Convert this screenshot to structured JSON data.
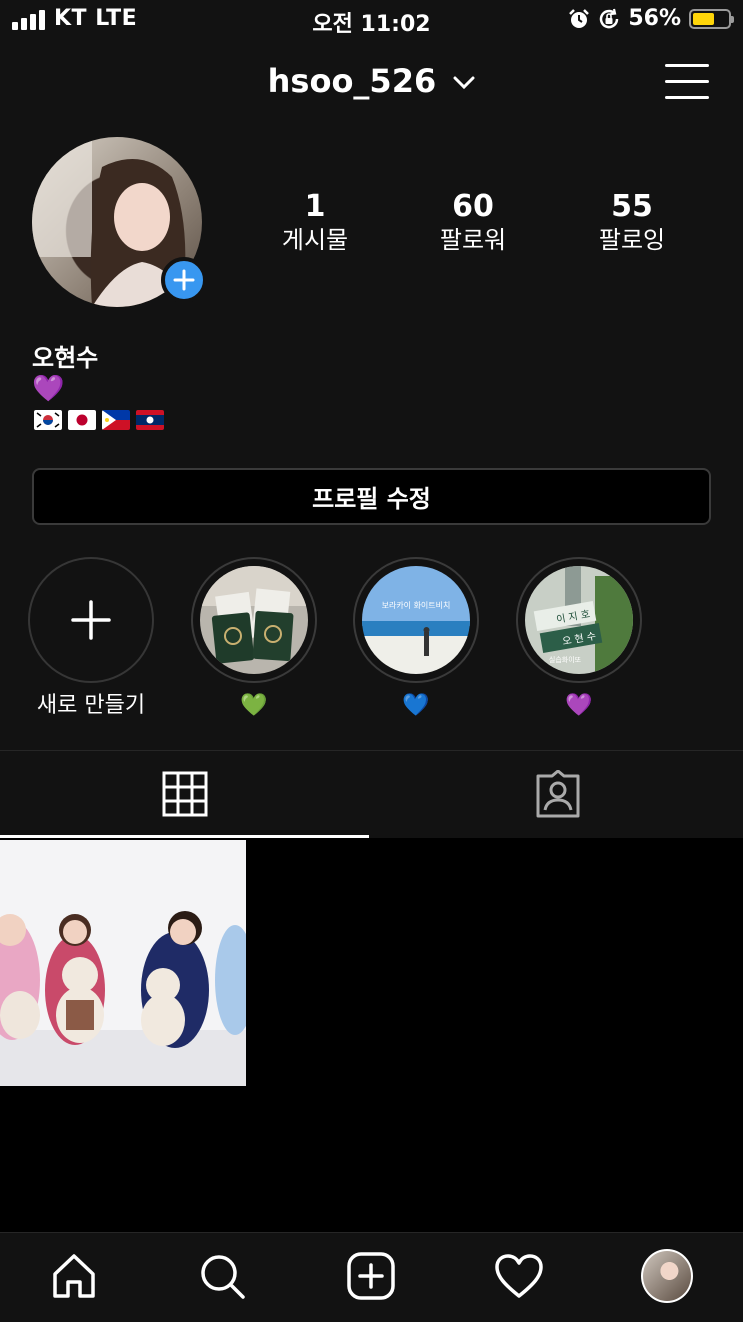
{
  "status_bar": {
    "carrier": "KT LTE",
    "time": "오전 11:02",
    "battery_percent": "56%",
    "battery_level": 0.56,
    "battery_color": "#ffd60a",
    "icons": [
      "signal-icon",
      "alarm-icon",
      "orientation-lock-icon",
      "battery-icon"
    ]
  },
  "header": {
    "username": "hsoo_526",
    "icons": [
      "chevron-down-icon",
      "menu-icon"
    ]
  },
  "profile": {
    "stats": [
      {
        "value": "1",
        "label": "게시물"
      },
      {
        "value": "60",
        "label": "팔로워"
      },
      {
        "value": "55",
        "label": "팔로잉"
      }
    ],
    "name": "오현수",
    "bio_line1": "💜",
    "bio_flags": [
      "korea-flag",
      "japan-flag",
      "philippines-flag",
      "laos-flag"
    ],
    "edit_button": "프로필 수정",
    "accent_color": "#3897f0"
  },
  "highlights": [
    {
      "label": "새로 만들기",
      "type": "new"
    },
    {
      "label": "💚",
      "type": "story"
    },
    {
      "label": "💙",
      "type": "story"
    },
    {
      "label": "💜",
      "type": "story"
    }
  ],
  "highlight_texts": {
    "beach": "보라카이 화이트비치",
    "sign_top": "이 지 호",
    "sign_bottom": "오 현 수",
    "sign_caption": "실습화이또"
  },
  "tabs": [
    {
      "name": "grid",
      "icon": "grid-icon",
      "selected": true
    },
    {
      "name": "tagged",
      "icon": "tagged-icon",
      "selected": false
    }
  ],
  "bottom_nav": [
    "home-icon",
    "search-icon",
    "new-post-icon",
    "heart-icon",
    "profile-avatar"
  ]
}
